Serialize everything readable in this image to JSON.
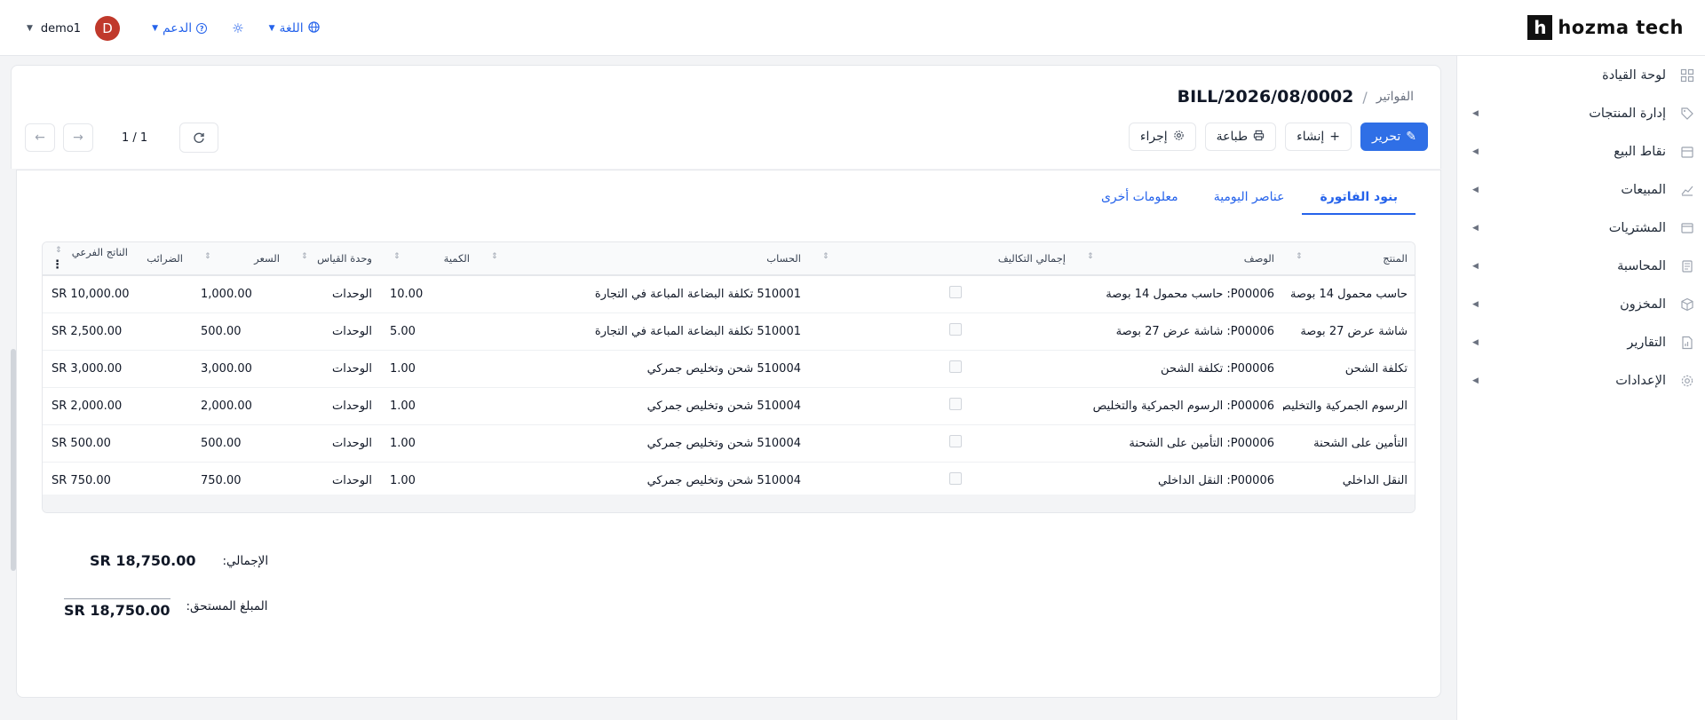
{
  "app": {
    "logo_text": "hozma tech",
    "logo_letter": "h"
  },
  "topbar": {
    "user_name": "demo1",
    "user_initial": "D",
    "support_label": "الدعم",
    "language_label": "اللغة"
  },
  "sidebar": {
    "items": [
      {
        "label": "لوحة القيادة",
        "icon": "dashboard-icon",
        "has_arrow": false
      },
      {
        "label": "إدارة المنتجات",
        "icon": "tag-icon",
        "has_arrow": true
      },
      {
        "label": "نقاط البيع",
        "icon": "store-icon",
        "has_arrow": true
      },
      {
        "label": "المبيعات",
        "icon": "chart-icon",
        "has_arrow": true
      },
      {
        "label": "المشتريات",
        "icon": "wallet-icon",
        "has_arrow": true
      },
      {
        "label": "المحاسبة",
        "icon": "ledger-icon",
        "has_arrow": true
      },
      {
        "label": "المخزون",
        "icon": "box-icon",
        "has_arrow": true
      },
      {
        "label": "التقارير",
        "icon": "report-icon",
        "has_arrow": true
      },
      {
        "label": "الإعدادات",
        "icon": "gear-icon",
        "has_arrow": true
      }
    ]
  },
  "breadcrumb": {
    "parent": "الفواتير",
    "separator": "/",
    "current": "BILL/2026/08/0002"
  },
  "actions": {
    "edit": "تحرير",
    "create": "إنشاء",
    "print": "طباعة",
    "action": "إجراء"
  },
  "pager": {
    "count": "1 / 1"
  },
  "tabs": [
    {
      "label": "بنود الفاتورة",
      "active": true
    },
    {
      "label": "عناصر اليومية",
      "active": false
    },
    {
      "label": "معلومات أخرى",
      "active": false
    }
  ],
  "table": {
    "columns": [
      "المنتج",
      "الوصف",
      "إجمالي التكاليف",
      "الحساب",
      "الكمية",
      "وحدة القياس",
      "السعر",
      "الضرائب",
      "الناتج الفرعي"
    ],
    "rows": [
      {
        "product": "حاسب محمول 14 بوصة",
        "description": "P00006: حاسب محمول 14 بوصة",
        "account": "510001 تكلفة البضاعة المباعة في التجارة",
        "qty": "10.00",
        "uom": "الوحدات",
        "price": "1,000.00",
        "taxes": "",
        "subtotal": "SR 10,000.00"
      },
      {
        "product": "شاشة عرض 27 بوصة",
        "description": "P00006: شاشة عرض 27 بوصة",
        "account": "510001 تكلفة البضاعة المباعة في التجارة",
        "qty": "5.00",
        "uom": "الوحدات",
        "price": "500.00",
        "taxes": "",
        "subtotal": "SR 2,500.00"
      },
      {
        "product": "تكلفة الشحن",
        "description": "P00006: تكلفة الشحن",
        "account": "510004 شحن وتخليص جمركي",
        "qty": "1.00",
        "uom": "الوحدات",
        "price": "3,000.00",
        "taxes": "",
        "subtotal": "SR 3,000.00"
      },
      {
        "product": "الرسوم الجمركية والتخليص",
        "description": "P00006: الرسوم الجمركية والتخليص",
        "account": "510004 شحن وتخليص جمركي",
        "qty": "1.00",
        "uom": "الوحدات",
        "price": "2,000.00",
        "taxes": "",
        "subtotal": "SR 2,000.00"
      },
      {
        "product": "التأمين على الشحنة",
        "description": "P00006: التأمين على الشحنة",
        "account": "510004 شحن وتخليص جمركي",
        "qty": "1.00",
        "uom": "الوحدات",
        "price": "500.00",
        "taxes": "",
        "subtotal": "SR 500.00"
      },
      {
        "product": "النقل الداخلي",
        "description": "P00006: النقل الداخلي",
        "account": "510004 شحن وتخليص جمركي",
        "qty": "1.00",
        "uom": "الوحدات",
        "price": "750.00",
        "taxes": "",
        "subtotal": "SR 750.00"
      }
    ]
  },
  "totals": {
    "total_label": "الإجمالي:",
    "total_value": "SR 18,750.00",
    "due_label": "المبلغ المستحق:",
    "due_value": "SR 18,750.00"
  }
}
